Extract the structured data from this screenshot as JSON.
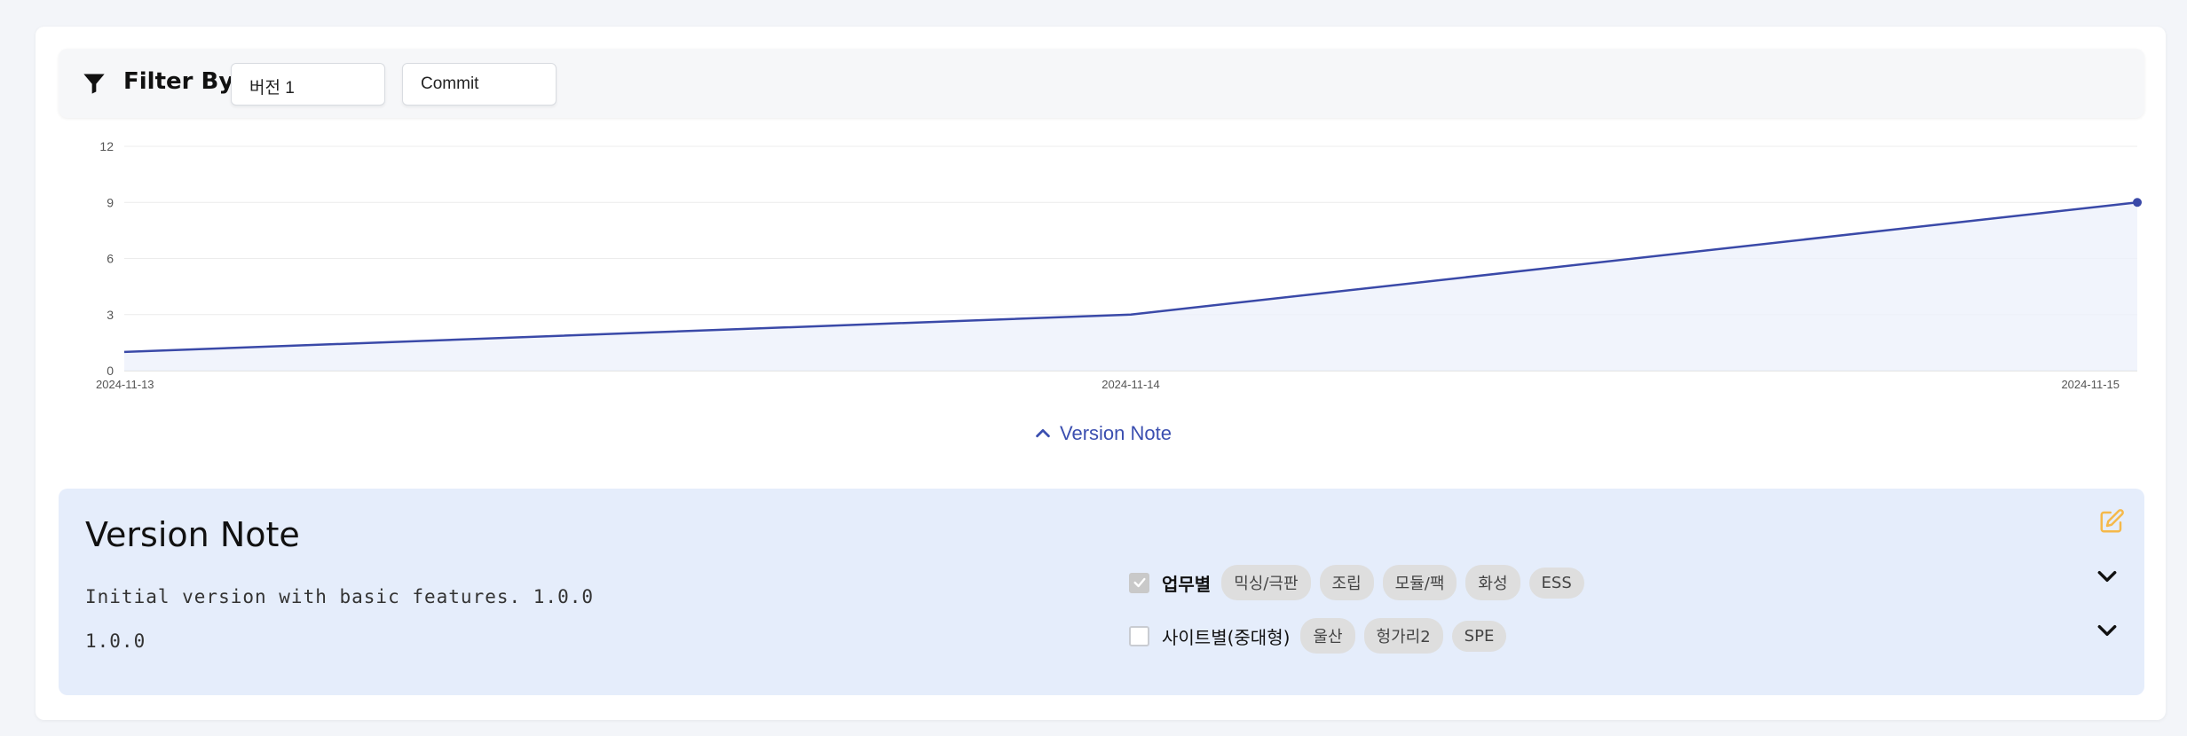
{
  "filter": {
    "label": "Filter By",
    "icon": "filter-icon",
    "version_select": {
      "value": "버전 1"
    },
    "type_select": {
      "value": "Commit"
    }
  },
  "chart_data": {
    "type": "area",
    "x": [
      "2024-11-13",
      "2024-11-14",
      "2024-11-15"
    ],
    "series": [
      {
        "values": [
          1,
          3,
          9
        ]
      }
    ],
    "y_ticks": [
      0,
      3,
      6,
      9,
      12
    ],
    "ylim": [
      0,
      12
    ],
    "grid": true,
    "line_color": "#3a49a8",
    "fill_color": "#eef1fb"
  },
  "toggle": {
    "label": "Version Note",
    "icon": "chevron-up-icon"
  },
  "note": {
    "title": "Version Note",
    "line1": "Initial version with basic features. 1.0.0",
    "line2": "1.0.0",
    "edit_icon": "edit-icon",
    "edit_color": "#f5b94a"
  },
  "categories": [
    {
      "label": "업무별",
      "checked": true,
      "chips": [
        "믹싱/극판",
        "조립",
        "모듈/팩",
        "화성",
        "ESS"
      ]
    },
    {
      "label": "사이트별(중대형)",
      "checked": false,
      "chips": [
        "울산",
        "헝가리2",
        "SPE"
      ]
    }
  ]
}
